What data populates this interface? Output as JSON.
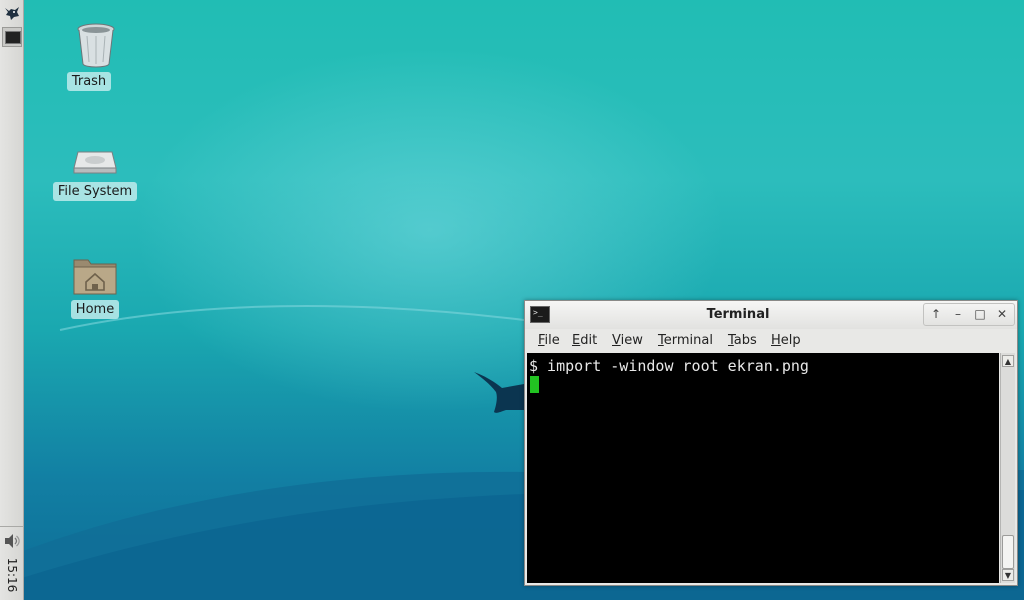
{
  "panel": {
    "clock": "15:16",
    "icons": {
      "menu": "xfce-mouse-icon",
      "task": "terminal-icon",
      "volume": "speaker-icon"
    }
  },
  "desktop": {
    "icons": [
      {
        "label": "Trash",
        "icon": "trash-icon"
      },
      {
        "label": "File System",
        "icon": "drive-icon"
      },
      {
        "label": "Home",
        "icon": "home-folder-icon"
      }
    ]
  },
  "terminal": {
    "title": "Terminal",
    "menu": [
      "File",
      "Edit",
      "View",
      "Terminal",
      "Tabs",
      "Help"
    ],
    "output_line": "$ import -window root ekran.png",
    "buttons": {
      "up": "↑",
      "minimize": "–",
      "maximize": "□",
      "close": "✕"
    },
    "cursor_color": "#22c322"
  },
  "colors": {
    "desktop_top": "#21bdb4",
    "desktop_bottom": "#0d6c96",
    "panel": "#e4e4e2"
  }
}
